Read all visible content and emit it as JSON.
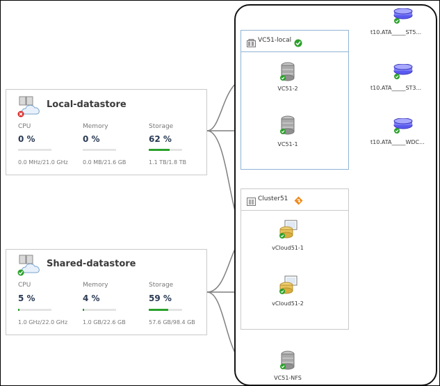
{
  "datastores": [
    {
      "name": "Local-datastore",
      "status": "error",
      "metrics": [
        {
          "label": "CPU",
          "value": "0 %",
          "fill": 0,
          "detail": "0.0 MHz/21.0 GHz"
        },
        {
          "label": "Memory",
          "value": "0 %",
          "fill": 0,
          "detail": "0.0 MB/21.6 GB"
        },
        {
          "label": "Storage",
          "value": "62 %",
          "fill": 0.62,
          "detail": "1.1 TB/1.8 TB"
        }
      ]
    },
    {
      "name": "Shared-datastore",
      "status": "ok",
      "metrics": [
        {
          "label": "CPU",
          "value": "5 %",
          "fill": 0.05,
          "detail": "1.0 GHz/22.0 GHz"
        },
        {
          "label": "Memory",
          "value": "4 %",
          "fill": 0.04,
          "detail": "1.0 GB/22.6 GB"
        },
        {
          "label": "Storage",
          "value": "59 %",
          "fill": 0.59,
          "detail": "57.6 GB/98.4 GB"
        }
      ]
    }
  ],
  "groups": {
    "vc51_local": {
      "title": "VC51-local",
      "status": "ok"
    },
    "cluster51": {
      "title": "Cluster51",
      "status": "warning"
    }
  },
  "hosts": {
    "vc51_2": "VC51-2",
    "vc51_1": "VC51-1",
    "vcloud51_1": "vCloud51-1",
    "vcloud51_2": "vCloud51-2",
    "vc51_nfs": "VC51-NFS"
  },
  "disks": {
    "d1": "t10.ATA_____ST5...",
    "d2": "t10.ATA_____ST3...",
    "d3": "t10.ATA_____WDC..."
  },
  "colors": {
    "ok": "#2aa02a",
    "error": "#d62b2b",
    "warning": "#f08a1c",
    "bar": "#2aa02a",
    "link": "#7f7f7f"
  }
}
